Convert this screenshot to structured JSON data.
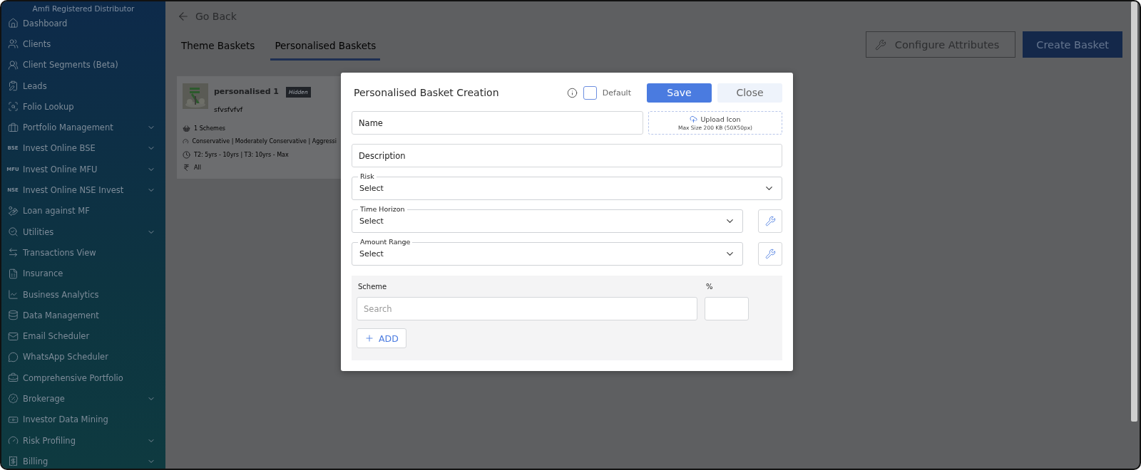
{
  "sidebar": {
    "header": "Amfi Registered Distributor",
    "items": [
      {
        "label": "Dashboard",
        "expandable": false
      },
      {
        "label": "Clients",
        "expandable": false
      },
      {
        "label": "Client Segments (Beta)",
        "expandable": false
      },
      {
        "label": "Leads",
        "expandable": false
      },
      {
        "label": "Folio Lookup",
        "expandable": false
      },
      {
        "label": "Portfolio Management",
        "expandable": true
      },
      {
        "label": "Invest Online BSE",
        "badge": "BSE",
        "expandable": true
      },
      {
        "label": "Invest Online MFU",
        "badge": "MFU",
        "expandable": true
      },
      {
        "label": "Invest Online NSE Invest",
        "badge": "NSE",
        "expandable": true
      },
      {
        "label": "Loan against MF",
        "expandable": false
      },
      {
        "label": "Utilities",
        "expandable": true
      },
      {
        "label": "Transactions View",
        "expandable": false
      },
      {
        "label": "Insurance",
        "expandable": false
      },
      {
        "label": "Business Analytics",
        "expandable": false
      },
      {
        "label": "Data Management",
        "expandable": false
      },
      {
        "label": "Email Scheduler",
        "expandable": false
      },
      {
        "label": "WhatsApp Scheduler",
        "expandable": false
      },
      {
        "label": "Comprehensive Portfolio",
        "expandable": false
      },
      {
        "label": "Brokerage",
        "expandable": true
      },
      {
        "label": "Investor Data Mining",
        "expandable": false
      },
      {
        "label": "Risk Profiling",
        "expandable": true
      },
      {
        "label": "Billing",
        "expandable": true
      }
    ]
  },
  "back_link": "Go Back",
  "tabs": [
    {
      "label": "Theme Baskets",
      "selected": false
    },
    {
      "label": "Personalised Baskets",
      "selected": true
    }
  ],
  "actions": [
    {
      "label": "Configure Attributes",
      "kind": "outline"
    },
    {
      "label": "Create Basket",
      "kind": "primary"
    }
  ],
  "basket_card": {
    "name": "personalised 1",
    "badge": "Hidden",
    "description": "sfvsfvfvf",
    "details": [
      "1 Schemes",
      "Conservative | Moderately Conservative | Aggressi",
      "T2: 5yrs - 10yrs | T3: 10yrs - Max",
      "All"
    ]
  },
  "dialog": {
    "title": "Personalised Basket Creation",
    "default_label": "Default",
    "default_checked": false,
    "save": "Save",
    "close": "Close",
    "name_placeholder": "Name",
    "upload_label": "Upload Icon",
    "upload_hint": "Max Size 200 KB (50X50px)",
    "description_placeholder": "Description",
    "selects": [
      {
        "label": "Risk",
        "value": "Select",
        "configurable": false
      },
      {
        "label": "Time Horizon",
        "value": "Select",
        "configurable": true
      },
      {
        "label": "Amount Range",
        "value": "Select",
        "configurable": true
      }
    ],
    "scheme_header": "Scheme",
    "percent_header": "%",
    "search_placeholder": "Search",
    "add_label": "ADD"
  }
}
